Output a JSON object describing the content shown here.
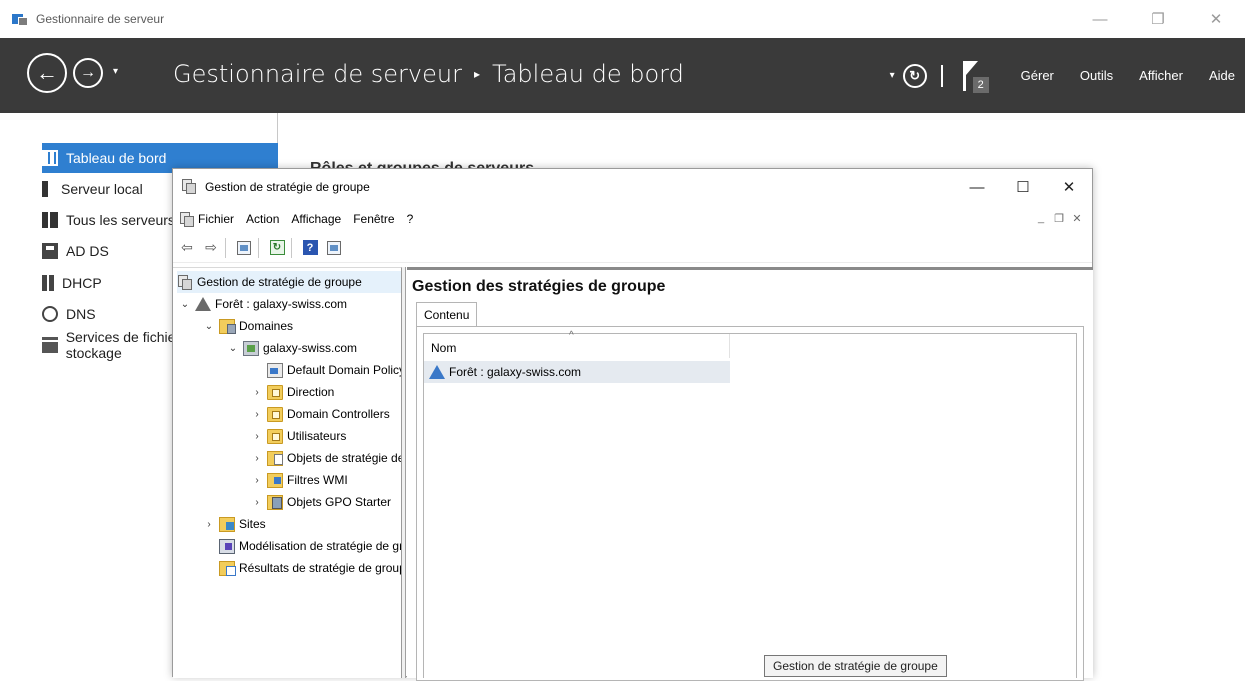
{
  "server_manager": {
    "window_title": "Gestionnaire de serveur",
    "controls": {
      "minimize": "—",
      "restore": "❐",
      "close": "✕"
    },
    "header": {
      "back_glyph": "←",
      "forward_glyph": "→",
      "dropdown_glyph": "▾",
      "breadcrumb": [
        "Gestionnaire de serveur",
        "Tableau de bord"
      ],
      "breadcrumb_sep": "▸",
      "refresh_glyph": "↻",
      "notification_count": "2",
      "menu": [
        "Gérer",
        "Outils",
        "Afficher",
        "Aide"
      ]
    },
    "sidebar": [
      {
        "label": "Tableau de bord",
        "icon": "dashboard-icon",
        "active": true
      },
      {
        "label": "Serveur local",
        "icon": "server-icon"
      },
      {
        "label": "Tous les serveurs",
        "icon": "all-servers-icon"
      },
      {
        "label": "AD DS",
        "icon": "ad-ds-icon"
      },
      {
        "label": "DHCP",
        "icon": "dhcp-icon"
      },
      {
        "label": "DNS",
        "icon": "dns-icon"
      },
      {
        "label": "Services de fichiers et de stockage",
        "icon": "file-services-icon"
      }
    ],
    "content_title": "Rôles et groupes de serveurs"
  },
  "gpmc": {
    "window_title": "Gestion de stratégie de groupe",
    "controls": {
      "minimize": "—",
      "maximize": "☐",
      "close": "✕"
    },
    "menu": [
      "Fichier",
      "Action",
      "Affichage",
      "Fenêtre",
      "?"
    ],
    "mdi_controls": {
      "minimize": "_",
      "restore": "❐",
      "close": "✕"
    },
    "toolbar": {
      "back": "⇦",
      "forward": "⇨",
      "refresh": "↻",
      "help": "?"
    },
    "tree": [
      {
        "label": "Gestion de stratégie de groupe",
        "depth": 0,
        "twisty": "",
        "icon": "gpmc-icon",
        "selected": true
      },
      {
        "label": "Forêt : galaxy-swiss.com",
        "depth": 1,
        "twisty": "⌄",
        "icon": "forest-icon"
      },
      {
        "label": "Domaines",
        "depth": 2,
        "twisty": "⌄",
        "icon": "domains-icon"
      },
      {
        "label": "galaxy-swiss.com",
        "depth": 3,
        "twisty": "⌄",
        "icon": "domain-icon"
      },
      {
        "label": "Default Domain Policy",
        "depth": 4,
        "twisty": "",
        "icon": "gpo-link-icon"
      },
      {
        "label": "Direction",
        "depth": 4,
        "twisty": "›",
        "icon": "ou-folder-icon"
      },
      {
        "label": "Domain Controllers",
        "depth": 4,
        "twisty": "›",
        "icon": "ou-folder-icon"
      },
      {
        "label": "Utilisateurs",
        "depth": 4,
        "twisty": "›",
        "icon": "ou-folder-icon"
      },
      {
        "label": "Objets de stratégie de groupe",
        "depth": 4,
        "twisty": "›",
        "icon": "gpo-objects-icon"
      },
      {
        "label": "Filtres WMI",
        "depth": 4,
        "twisty": "›",
        "icon": "wmi-filters-icon"
      },
      {
        "label": "Objets GPO Starter",
        "depth": 4,
        "twisty": "›",
        "icon": "starter-gpo-icon"
      },
      {
        "label": "Sites",
        "depth": 1,
        "twisty": "›",
        "icon": "sites-icon"
      },
      {
        "label": "Modélisation de stratégie de groupe",
        "depth": 2,
        "twisty": "",
        "icon": "modeling-icon"
      },
      {
        "label": "Résultats de stratégie de groupe",
        "depth": 2,
        "twisty": "",
        "icon": "results-icon"
      }
    ],
    "main": {
      "title": "Gestion des stratégies de groupe",
      "tab": "Contenu",
      "column_header": "Nom",
      "sort_glyph": "^",
      "rows": [
        "Forêt : galaxy-swiss.com"
      ]
    },
    "tooltip": "Gestion de stratégie de groupe"
  }
}
